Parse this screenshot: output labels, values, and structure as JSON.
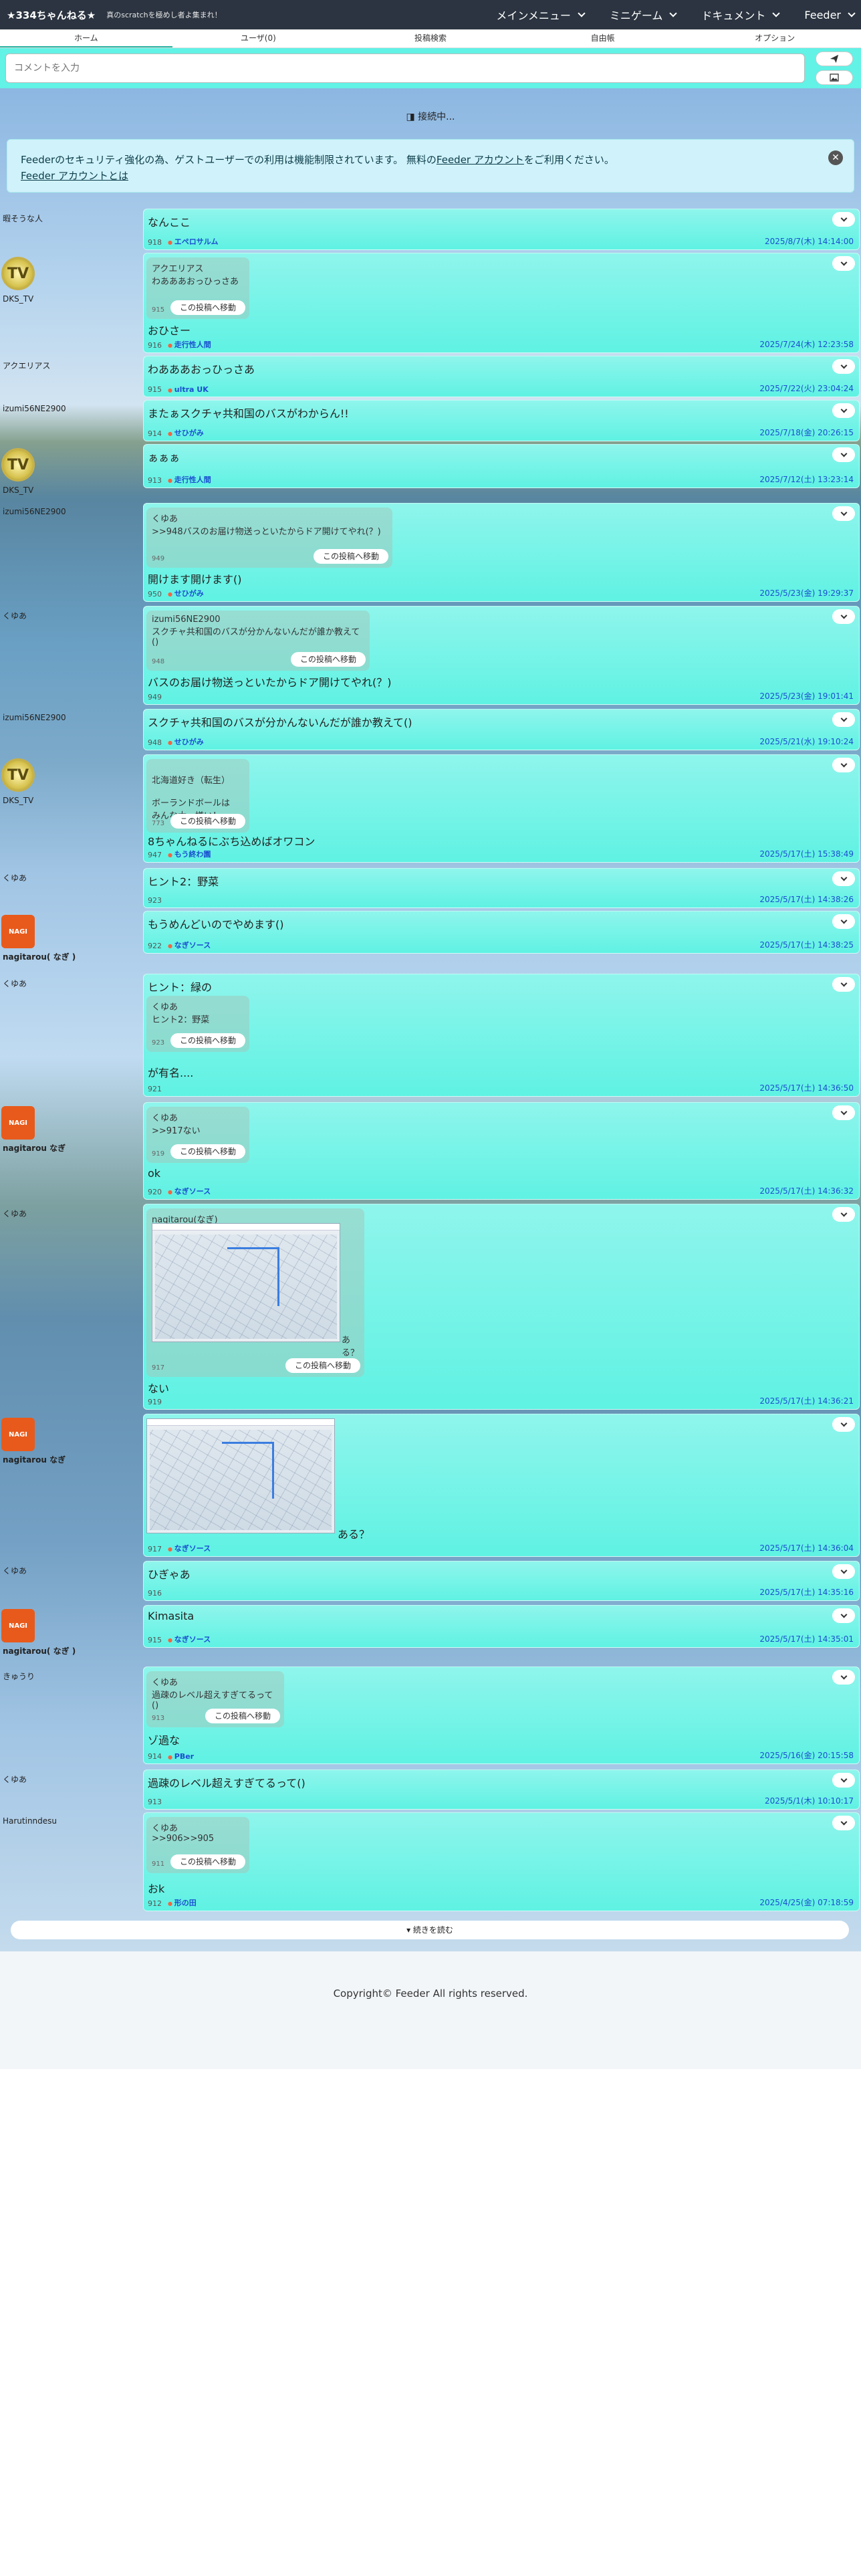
{
  "header": {
    "brand": "★334ちゃんねる★",
    "tagline": "真のscratchを極めし者よ集まれ！",
    "nav": [
      "メインメニュー",
      "ミニゲーム",
      "ドキュメント",
      "Feeder"
    ]
  },
  "tabs": [
    "ホーム",
    "ユーザ(0)",
    "投稿検索",
    "自由帳",
    "オプション"
  ],
  "composer": {
    "placeholder": "コメントを入力",
    "send_icon": "paper-plane-icon",
    "image_icon": "image-icon"
  },
  "status": "接続中...",
  "notice": {
    "text_before": "Feederのセキュリティ強化の為、ゲストユーザーでの利用は機能制限されています。 無料の",
    "link1": "Feeder アカウント",
    "text_after": "をご利用ください。",
    "link2": "Feeder アカウントとは"
  },
  "jump_label": "この投稿へ移動",
  "posts": [
    {
      "user": "暇そうな人",
      "text": "なんここ",
      "num": "918",
      "author": "エペロサルム",
      "time": "2025/8/7(木) 14:14:00"
    },
    {
      "user": "DKS_TV",
      "quote_user": "アクエリアス",
      "quote_text": "わあああおっひっさあ",
      "quote_num": "915",
      "text": "おひさー",
      "num": "916",
      "author": "走行性人間",
      "time": "2025/7/24(木) 12:23:58"
    },
    {
      "user": "アクエリアス",
      "text": "わあああおっひっさあ",
      "num": "915",
      "author": "ultra UK",
      "time": "2025/7/22(火) 23:04:24"
    },
    {
      "user": "izumi56NE2900",
      "text": "またぁスクチャ共和国のバスがわからん!!",
      "num": "914",
      "author": "せひがみ",
      "time": "2025/7/18(金) 20:26:15"
    },
    {
      "user": "DKS_TV",
      "text": "ぁぁぁ",
      "num": "913",
      "author": "走行性人間",
      "time": "2025/7/12(土) 13:23:14"
    },
    {
      "user": "izumi56NE2900",
      "quote_user": "くゆあ",
      "quote_text": ">>948バスのお届け物送っといたからドア開けてやれ(？)",
      "quote_num": "949",
      "text": "開けます開けます()",
      "num": "950",
      "author": "せひがみ",
      "time": "2025/5/23(金) 19:29:37"
    },
    {
      "user": "くゆあ",
      "quote_user": "izumi56NE2900",
      "quote_text": "スクチャ共和国のバスが分かんないんだが誰か教えて()",
      "quote_num": "948",
      "text": "バスのお届け物送っといたからドア開けてやれ(？)",
      "num": "949",
      "author": "",
      "time": "2025/5/23(金) 19:01:41"
    },
    {
      "user": "izumi56NE2900",
      "text": "スクチャ共和国のバスが分かんないんだが誰か教えて()",
      "num": "948",
      "author": "せひがみ",
      "time": "2025/5/21(水) 19:10:24"
    },
    {
      "user": "DKS_TV",
      "quote_user": "北海道好き（転生）",
      "quote_text": "ボーランドボールは\nみんな大っ嫌い！",
      "quote_num": "773",
      "text": "8ちゃんねるにぶち込めばオワコン",
      "num": "947",
      "author": "もう終わ園",
      "time": "2025/5/17(土) 15:38:49"
    },
    {
      "user": "くゆあ",
      "text": "ヒント2：野菜",
      "num": "923",
      "author": "",
      "time": "2025/5/17(土) 14:38:26"
    },
    {
      "user": "nagitarou",
      "badge": "なぎ",
      "text": "もうめんどいのでやめます()",
      "num": "922",
      "author": "なぎソース",
      "time": "2025/5/17(土) 14:38:25"
    },
    {
      "user": "くゆあ",
      "quote_user": "くゆあ",
      "quote_text": "ヒント2：野菜",
      "quote_num": "923",
      "pretext": "ヒント：緑の",
      "text": "が有名....",
      "num": "921",
      "author": "",
      "time": "2025/5/17(土) 14:36:50"
    },
    {
      "user": "nagitarou",
      "badge": "なぎ",
      "quote_user": "くゆあ",
      "quote_text": ">>917ない",
      "quote_num": "919",
      "text": "ok",
      "num": "920",
      "author": "なぎソース",
      "time": "2025/5/17(土) 14:36:32"
    },
    {
      "user": "くゆあ",
      "quote_user": "nagitarou(なぎ)",
      "quote_text": "ある？",
      "quote_num": "917",
      "text": "ない",
      "num": "919",
      "author": "",
      "time": "2025/5/17(土) 14:36:21"
    },
    {
      "user": "nagitarou",
      "badge": "なぎ",
      "text": "ある？",
      "num": "917",
      "author": "なぎソース",
      "time": "2025/5/17(土) 14:36:04"
    },
    {
      "user": "くゆあ",
      "text": "ひぎゃあ",
      "num": "916",
      "author": "",
      "time": "2025/5/17(土) 14:35:16"
    },
    {
      "user": "nagitarou",
      "badge": "なぎ",
      "text": "Kimasita",
      "num": "915",
      "author": "なぎソース",
      "time": "2025/5/17(土) 14:35:01"
    },
    {
      "user": "きゅうり",
      "quote_user": "くゆあ",
      "quote_text": "過疎のレベル超えすぎてるって()",
      "quote_num": "913",
      "text": "ゾ過な",
      "num": "914",
      "author": "PBer",
      "time": "2025/5/16(金) 20:15:58"
    },
    {
      "user": "くゆあ",
      "text": "過疎のレベル超えすぎてるって()",
      "num": "913",
      "author": "",
      "time": "2025/5/1(木) 10:10:17"
    },
    {
      "user": "Harutinndesu",
      "quote_user": "くゆあ",
      "quote_text": ">>906>>905",
      "quote_num": "911",
      "text": "おk",
      "num": "912",
      "author": "形の田",
      "time": "2025/4/25(金) 07:18:59"
    }
  ],
  "load_more": "▾ 続きを読む",
  "footer": "Copyright© Feeder All rights reserved."
}
